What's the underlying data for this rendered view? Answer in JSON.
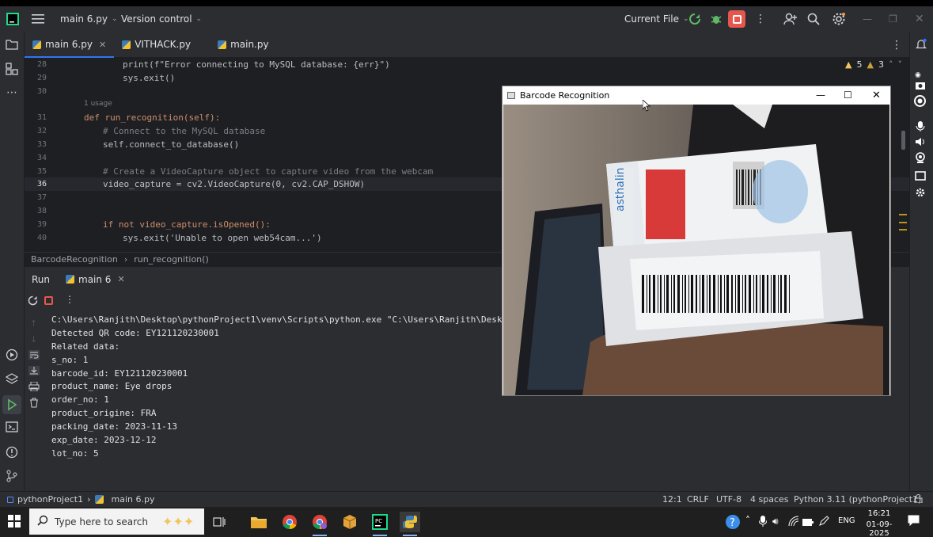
{
  "titlebar": {
    "project": "main 6.py",
    "vcs": "Version control",
    "run_config": "Current File"
  },
  "tabs": [
    {
      "label": "main 6.py",
      "active": true,
      "closable": true
    },
    {
      "label": "VITHACK.py",
      "active": false,
      "closable": false
    },
    {
      "label": "main.py",
      "active": false,
      "closable": false
    }
  ],
  "editor": {
    "warnings": {
      "warn_count": "5",
      "weak_count": "3"
    },
    "lines": [
      {
        "n": "28",
        "text": "print(f\"Error connecting to MySQL database: {err}\")"
      },
      {
        "n": "29",
        "text": "sys.exit()"
      },
      {
        "n": "30",
        "text": ""
      },
      {
        "n": "",
        "text": "1 usage"
      },
      {
        "n": "31",
        "text": "def run_recognition(self):"
      },
      {
        "n": "32",
        "text": "# Connect to the MySQL database"
      },
      {
        "n": "33",
        "text": "self.connect_to_database()"
      },
      {
        "n": "34",
        "text": ""
      },
      {
        "n": "35",
        "text": "# Create a VideoCapture object to capture video from the webcam"
      },
      {
        "n": "36",
        "text": "video_capture = cv2.VideoCapture(0, cv2.CAP_DSHOW)"
      },
      {
        "n": "37",
        "text": ""
      },
      {
        "n": "38",
        "text": ""
      },
      {
        "n": "39",
        "text": "if not video_capture.isOpened():"
      },
      {
        "n": "40",
        "text": "sys.exit('Unable to open web54cam...')"
      }
    ]
  },
  "breadcrumb": [
    "BarcodeRecognition",
    "run_recognition()"
  ],
  "run": {
    "title": "Run",
    "tab": "main 6",
    "output": [
      "C:\\Users\\Ranjith\\Desktop\\pythonProject1\\venv\\Scripts\\python.exe \"C:\\Users\\Ranjith\\Desktop\\pyt",
      "Detected QR code: EY121120230001",
      "Related data:",
      "s_no: 1",
      "barcode_id: EY121120230001",
      "product_name: Eye drops",
      "order_no: 1",
      "product_origine: FRA",
      "packing_date: 2023-11-13",
      "exp_date: 2023-12-12",
      "lot_no: 5"
    ]
  },
  "statusbar": {
    "project": "pythonProject1",
    "file": "main 6.py",
    "position": "12:1",
    "line_sep": "CRLF",
    "encoding": "UTF-8",
    "indent": "4 spaces",
    "interpreter": "Python 3.11 (pythonProject1)"
  },
  "barcode_window": {
    "title": "Barcode Recognition",
    "box_brand": "asthalin"
  },
  "taskbar": {
    "search_placeholder": "Type here to search",
    "tray_lang": "ENG",
    "time": "16:21",
    "date": "01-09-2025"
  },
  "colors": {
    "accent": "#3574f0",
    "run_green": "#5fb865",
    "stop_red": "#e5574d"
  }
}
